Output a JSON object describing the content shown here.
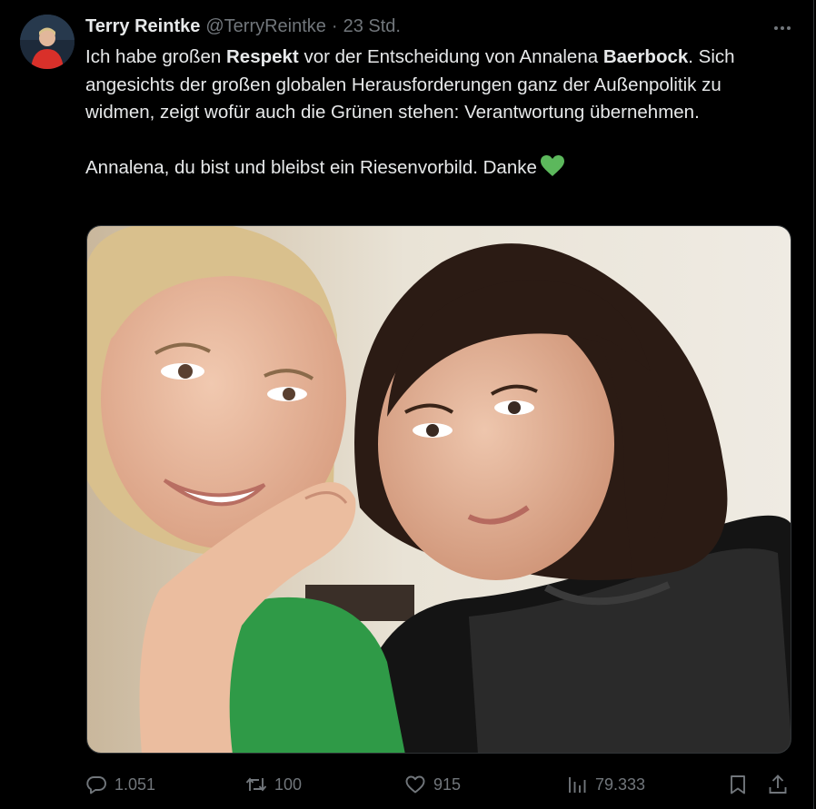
{
  "author": {
    "display_name": "Terry Reintke",
    "handle": "@TerryReintke",
    "separator": "·",
    "time": "23 Std."
  },
  "tweet": {
    "p1_part1": "Ich habe großen ",
    "p1_bold1": "Respekt",
    "p1_part2": " vor der Entscheidung von Annalena ",
    "p1_bold2": "Baerbock",
    "p1_part3": ". Sich angesichts der großen globalen Herausforderungen ganz der Außenpolitik zu widmen, zeigt wofür auch die Grünen stehen: Verantwortung übernehmen.",
    "p2_text": "Annalena, du bist und bleibst ein Riesenvorbild. Danke",
    "emoji": "green-heart-emoji"
  },
  "stats": {
    "replies": "1.051",
    "reposts": "100",
    "likes": "915",
    "views": "79.333"
  },
  "icons": {
    "more": "more-icon",
    "reply": "reply-icon",
    "repost": "repost-icon",
    "like": "heart-icon",
    "views": "views-icon",
    "bookmark": "bookmark-icon",
    "share": "share-icon"
  },
  "colors": {
    "background": "#000000",
    "text": "#e7e9ea",
    "muted": "#71767b",
    "heart_green": "#5cb85c"
  }
}
